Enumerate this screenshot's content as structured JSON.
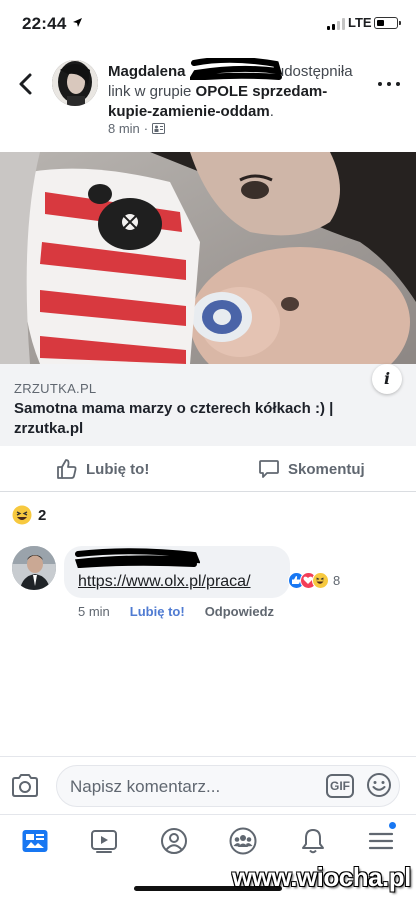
{
  "status_bar": {
    "time": "22:44",
    "network": "LTE"
  },
  "post": {
    "author": "Magdalena",
    "action": "udostępniła link w grupie",
    "group": "OPOLE sprzedam-kupie-zamienie-oddam",
    "time": "8 min",
    "icons": [
      "back-arrow-icon",
      "more-icon",
      "group-audience-icon"
    ]
  },
  "link_preview": {
    "domain": "ZRZUTKA.PL",
    "title": "Samotna mama marzy o czterech kółkach :) | zrzutka.pl",
    "info_label": "i"
  },
  "actions": {
    "like_label": "Lubię to!",
    "comment_label": "Skomentuj"
  },
  "reactions": {
    "count": "2",
    "icon": "haha-emoji-icon"
  },
  "comment": {
    "link": "https://www.olx.pl/praca/",
    "reaction_count": "8",
    "reaction_icons": [
      "like-reaction-icon",
      "love-reaction-icon",
      "haha-reaction-icon"
    ],
    "time": "5 min",
    "like_label": "Lubię to!",
    "reply_label": "Odpowiedz"
  },
  "composer": {
    "placeholder": "Napisz komentarz...",
    "gif_label": "GIF"
  },
  "tab_bar": {
    "tabs": [
      "news-feed-icon",
      "watch-icon",
      "profile-icon",
      "groups-icon",
      "notifications-icon",
      "menu-icon"
    ]
  },
  "watermark": "www.wiocha.pl",
  "colors": {
    "accent": "#1877f2",
    "link_blue": "#4f7bd2",
    "text_primary": "#1c1e21",
    "text_secondary": "#606770",
    "preview_bg": "#f2f3f5"
  }
}
